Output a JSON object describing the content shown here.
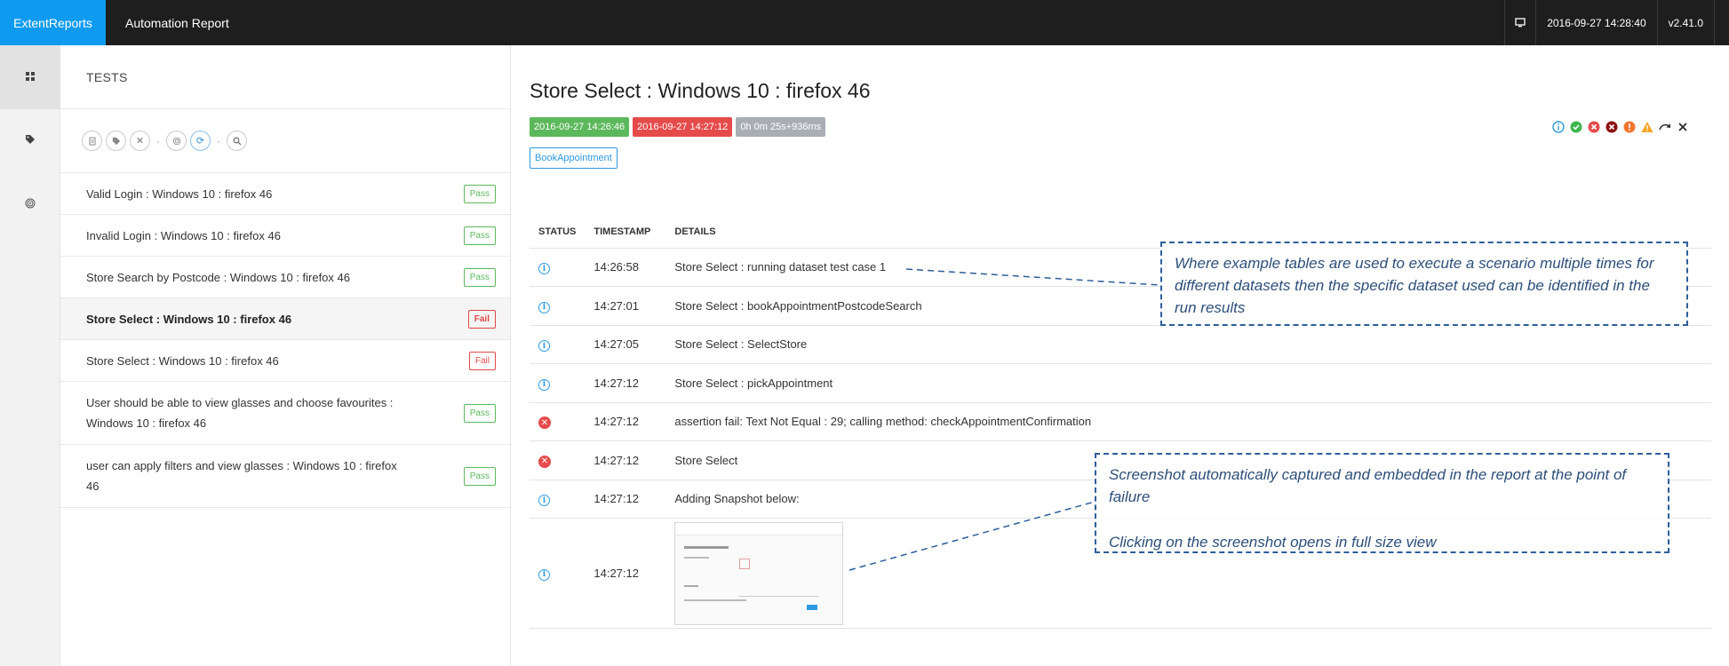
{
  "header": {
    "brand": "ExtentReports",
    "report_name": "Automation Report",
    "datetime": "2016-09-27 14:28:40",
    "version": "v2.41.0"
  },
  "nav": {
    "items": [
      {
        "icon": "dashboard-icon"
      },
      {
        "icon": "tag-icon"
      },
      {
        "icon": "fingerprint-icon"
      }
    ]
  },
  "tests_panel": {
    "title": "TESTS",
    "toolbar_icons": [
      "list-icon",
      "tag-icon",
      "close-icon",
      "fingerprint-icon",
      "refresh-icon",
      "search-icon"
    ],
    "tests": [
      {
        "name": "Valid Login : Windows 10 : firefox 46",
        "status": "Pass"
      },
      {
        "name": "Invalid Login : Windows 10 : firefox 46",
        "status": "Pass"
      },
      {
        "name": "Store Search by Postcode : Windows 10 : firefox 46",
        "status": "Pass"
      },
      {
        "name": "Store Select : Windows 10 : firefox 46",
        "status": "Fail"
      },
      {
        "name": "Store Select : Windows 10 : firefox 46",
        "status": "Fail"
      },
      {
        "name": "User should be able to view glasses and choose favourites : Windows 10 : firefox 46",
        "status": "Pass"
      },
      {
        "name": "user can apply filters and view glasses : Windows 10 : firefox 46",
        "status": "Pass"
      }
    ]
  },
  "detail": {
    "title": "Store Select : Windows 10 : firefox 46",
    "start_time": "2016-09-27 14:26:46",
    "end_time": "2016-09-27 14:27:12",
    "duration": "0h 0m 25s+936ms",
    "category": "BookAppointment",
    "columns": {
      "status": "STATUS",
      "timestamp": "TIMESTAMP",
      "details": "DETAILS"
    },
    "steps": [
      {
        "status": "info",
        "timestamp": "14:26:58",
        "details": "Store Select : running dataset test case 1"
      },
      {
        "status": "info",
        "timestamp": "14:27:01",
        "details": "Store Select : bookAppointmentPostcodeSearch"
      },
      {
        "status": "info",
        "timestamp": "14:27:05",
        "details": "Store Select : SelectStore"
      },
      {
        "status": "info",
        "timestamp": "14:27:12",
        "details": "Store Select : pickAppointment"
      },
      {
        "status": "fail",
        "timestamp": "14:27:12",
        "details": "assertion fail: Text Not Equal : 29; calling method: checkAppointmentConfirmation"
      },
      {
        "status": "fail",
        "timestamp": "14:27:12",
        "details": "Store Select"
      },
      {
        "status": "info",
        "timestamp": "14:27:12",
        "details": "Adding Snapshot below:"
      },
      {
        "status": "info",
        "timestamp": "14:27:12",
        "details": ""
      }
    ]
  },
  "annotations": {
    "dataset_note": "Where example tables are used to execute a scenario multiple times for different datasets then the specific dataset used can be identified in the run results",
    "screenshot_note_1": "Screenshot automatically captured and embedded in the report at the point of failure",
    "screenshot_note_2": "Clicking on the screenshot opens in full size view"
  },
  "colors": {
    "brand": "#0e9aef",
    "pass": "#5cb85c",
    "fail": "#e54b4b",
    "annotation": "#2d5e9a"
  }
}
